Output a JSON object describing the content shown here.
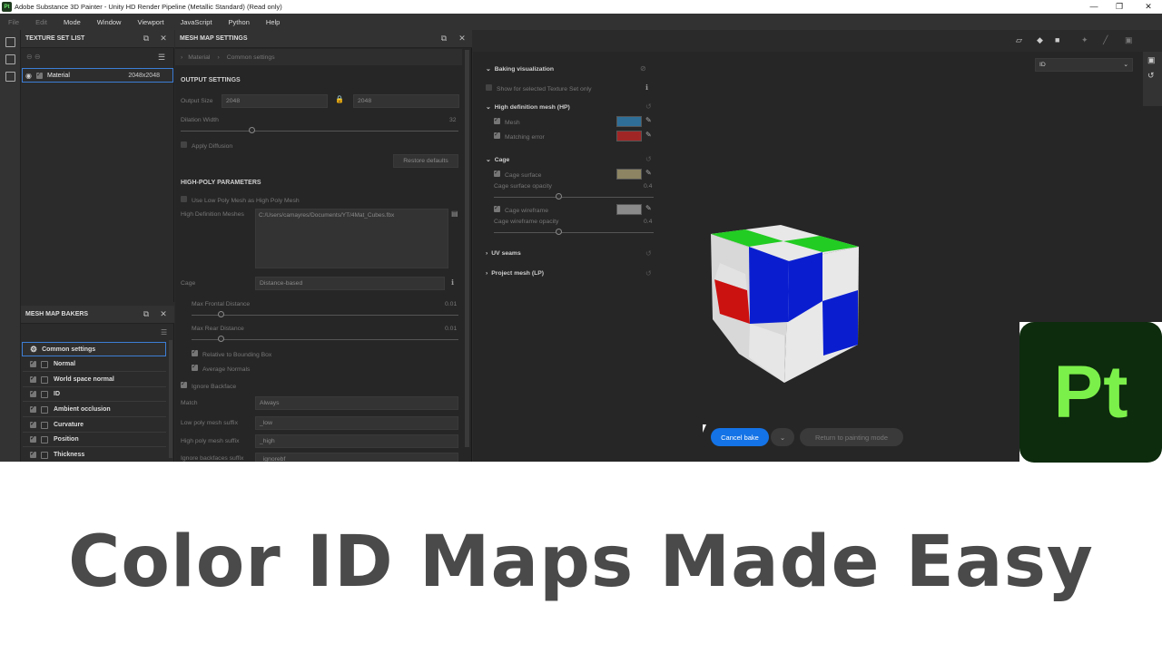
{
  "window": {
    "title": "Adobe Substance 3D Painter - Unity HD Render Pipeline (Metallic Standard) (Read only)",
    "app_icon": "Pt",
    "minimize": "—",
    "restore": "❐",
    "close": "✕"
  },
  "menu": [
    "File",
    "Edit",
    "Mode",
    "Window",
    "Viewport",
    "JavaScript",
    "Python",
    "Help"
  ],
  "texture_set_list": {
    "title": "TEXTURE SET LIST",
    "item_name": "Material",
    "item_size": "2048x2048"
  },
  "mesh_map_bakers": {
    "title": "MESH MAP BAKERS",
    "items": [
      "Common settings",
      "Normal",
      "World space normal",
      "ID",
      "Ambient occlusion",
      "Curvature",
      "Position",
      "Thickness"
    ]
  },
  "mesh_map_settings": {
    "title": "MESH MAP SETTINGS",
    "breadcrumb": [
      "Material",
      "Common settings"
    ],
    "output_settings": "OUTPUT SETTINGS",
    "output_size_label": "Output Size",
    "output_size_a": "2048",
    "output_size_b": "2048",
    "dilation_label": "Dilation Width",
    "dilation_value": "32",
    "apply_diffusion": "Apply Diffusion",
    "restore_defaults": "Restore defaults",
    "high_poly_params": "HIGH-POLY PARAMETERS",
    "use_low_poly": "Use Low Poly Mesh as High Poly Mesh",
    "hd_meshes_label": "High Definition Meshes",
    "hd_meshes_value": "C:/Users/camayres/Documents/YT/4Mat_Cubes.fbx",
    "cage_label": "Cage",
    "cage_value": "Distance-based",
    "max_frontal": "Max Frontal Distance",
    "max_frontal_value": "0.01",
    "max_rear": "Max Rear Distance",
    "max_rear_value": "0.01",
    "relative_bb": "Relative to Bounding Box",
    "average_normals": "Average Normals",
    "ignore_backface": "Ignore Backface",
    "match_label": "Match",
    "match_value": "Always",
    "low_suffix_label": "Low poly mesh suffix",
    "low_suffix_value": "_low",
    "high_suffix_label": "High poly mesh suffix",
    "high_suffix_value": "_high",
    "ignore_suffix_label": "Ignore backfaces suffix",
    "ignore_suffix_value": "_ignorebf"
  },
  "viewport": {
    "display_dropdown": "ID",
    "baking_visualization": "Baking visualization",
    "show_selected": "Show for selected Texture Set only",
    "hd_mesh_section": "High definition mesh (HP)",
    "mesh": "Mesh",
    "matching_error": "Matching error",
    "cage_section": "Cage",
    "cage_surface": "Cage surface",
    "cage_surface_opacity": "Cage surface opacity",
    "cage_surface_opacity_value": "0.4",
    "cage_wireframe": "Cage wireframe",
    "cage_wireframe_opacity": "Cage wireframe opacity",
    "cage_wireframe_opacity_value": "0.4",
    "uv_seams": "UV seams",
    "project_mesh": "Project mesh (LP)",
    "cancel_bake": "Cancel bake",
    "return_painting": "Return to painting mode"
  },
  "colors": {
    "mesh_swatch": "#2f6f97",
    "error_swatch": "#a02626",
    "cage_swatch": "#8c8462",
    "wire_swatch": "#8a8a8a",
    "accent": "#1473e6"
  },
  "logo_text": "Pt",
  "headline": "Color ID Maps Made Easy"
}
